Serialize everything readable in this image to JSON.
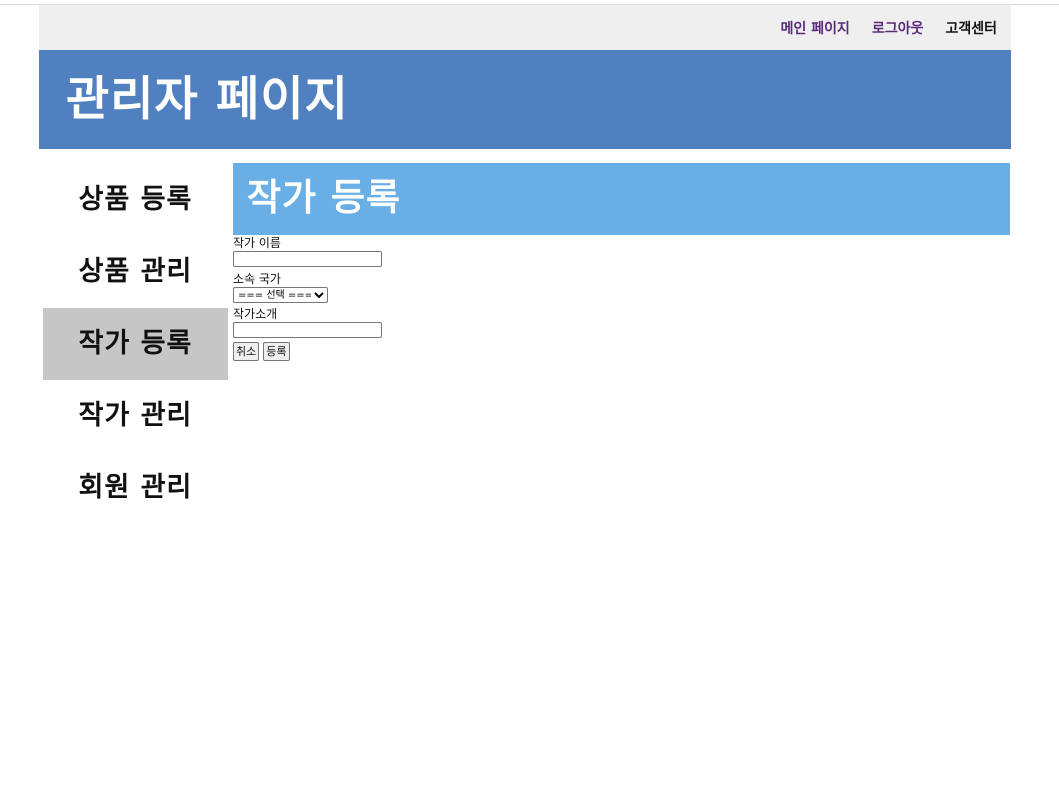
{
  "topbar": {
    "links": {
      "mypage": "메인 페이지",
      "logout": "로그아웃",
      "support": "고객센터"
    }
  },
  "header": {
    "title": "관리자 페이지"
  },
  "sidebar": {
    "items": [
      {
        "label": "상품 등록",
        "active": false
      },
      {
        "label": "상품 관리",
        "active": false
      },
      {
        "label": "작가 등록",
        "active": true
      },
      {
        "label": "작가 관리",
        "active": false
      },
      {
        "label": "회원 관리",
        "active": false
      }
    ]
  },
  "main": {
    "section_title": "작가 등록",
    "form": {
      "name_label": "작가 이름",
      "name_value": "",
      "country_label": "소속 국가",
      "country_selected": "=== 선택 ===",
      "intro_label": "작가소개",
      "intro_value": "",
      "cancel_label": "취소",
      "submit_label": "등록"
    }
  },
  "colors": {
    "topbar_bg": "#efefef",
    "header_bg": "#5080bf",
    "section_title_bg": "#6aaee6",
    "sidebar_active_bg": "#c6c6c6",
    "link_color": "#5a2a7a"
  }
}
